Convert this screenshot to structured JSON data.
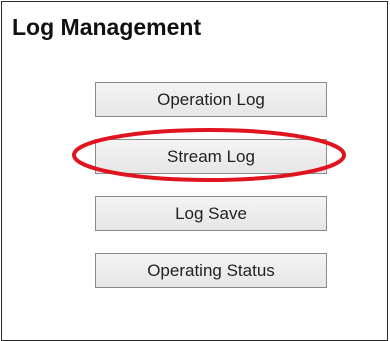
{
  "panel": {
    "title": "Log Management"
  },
  "buttons": {
    "operation_log": "Operation Log",
    "stream_log": "Stream Log",
    "log_save": "Log Save",
    "operating_status": "Operating Status"
  },
  "colors": {
    "highlight": "#e0141e",
    "button_border": "#8a8a8a",
    "panel_border": "#2a2a2a"
  }
}
